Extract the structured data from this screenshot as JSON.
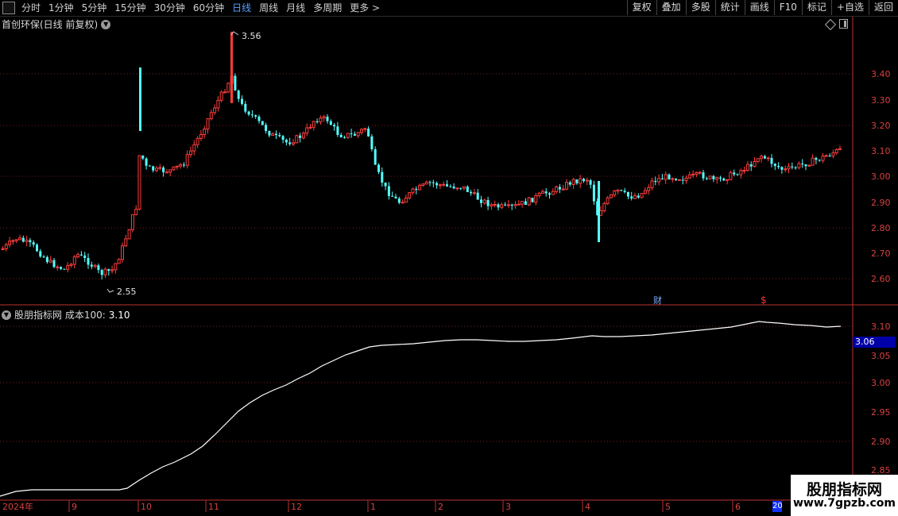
{
  "toolbar": {
    "periods": [
      "分时",
      "1分钟",
      "5分钟",
      "15分钟",
      "30分钟",
      "60分钟",
      "日线",
      "周线",
      "月线",
      "多周期",
      "更多 >"
    ],
    "active_period": "日线",
    "right_buttons": [
      "复权",
      "叠加",
      "多股",
      "统计",
      "画线",
      "F10",
      "标记",
      "+自选",
      "返回"
    ]
  },
  "main_chart": {
    "title": "首创环保(日线 前复权)",
    "price_axis": [
      "3.40",
      "3.30",
      "3.20",
      "3.10",
      "3.00",
      "2.90",
      "2.80",
      "2.70",
      "2.60"
    ],
    "high_label": "3.56",
    "low_label": "2.55",
    "event_labels": {
      "cai": "财",
      "dollar": "$"
    }
  },
  "indicator": {
    "title": "股朋指标网 成本100:",
    "value": "3.10",
    "axis": [
      "3.10",
      "3.05",
      "3.00",
      "2.95",
      "2.90",
      "2.85"
    ],
    "current_badge": "3.06"
  },
  "time_axis": [
    "2024年",
    "9",
    "10",
    "11",
    "12",
    "1",
    "2",
    "3",
    "4",
    "5",
    "6",
    "20"
  ],
  "watermark": {
    "title": "股朋指标网",
    "url": "www.7gpzb.com"
  },
  "colors": {
    "up": "#ff3c3c",
    "down": "#54ffff",
    "axis": "#c03030",
    "grid": "#7a1a1a"
  }
}
